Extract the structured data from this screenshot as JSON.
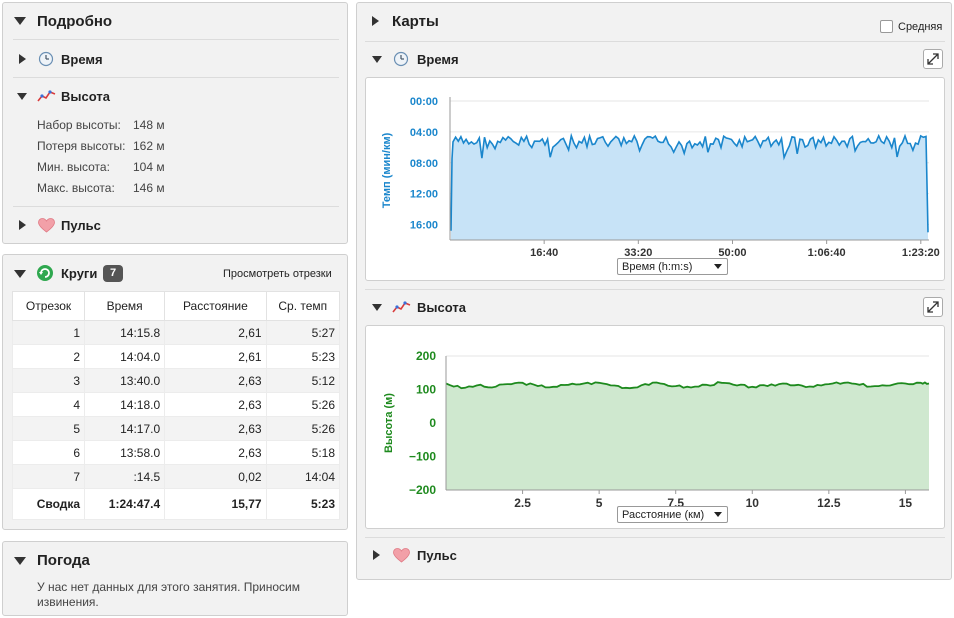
{
  "details": {
    "title": "Подробно",
    "time_label": "Время",
    "elevation": {
      "label": "Высота",
      "rows": [
        {
          "label": "Набор высоты:",
          "value": "148 м"
        },
        {
          "label": "Потеря высоты:",
          "value": "162 м"
        },
        {
          "label": "Мин. высота:",
          "value": "104 м"
        },
        {
          "label": "Макс. высота:",
          "value": "146 м"
        }
      ]
    },
    "pulse_label": "Пульс"
  },
  "laps": {
    "title": "Круги",
    "count": "7",
    "view_segments": "Просмотреть отрезки",
    "headers": [
      "Отрезок",
      "Время",
      "Расстояние",
      "Ср. темп"
    ],
    "rows": [
      [
        "1",
        "14:15.8",
        "2,61",
        "5:27"
      ],
      [
        "2",
        "14:04.0",
        "2,61",
        "5:23"
      ],
      [
        "3",
        "13:40.0",
        "2,63",
        "5:12"
      ],
      [
        "4",
        "14:18.0",
        "2,63",
        "5:26"
      ],
      [
        "5",
        "14:17.0",
        "2,63",
        "5:26"
      ],
      [
        "6",
        "13:58.0",
        "2,63",
        "5:18"
      ],
      [
        "7",
        ":14.5",
        "0,02",
        "14:04"
      ]
    ],
    "summary": [
      "Сводка",
      "1:24:47.4",
      "15,77",
      "5:23"
    ]
  },
  "weather": {
    "title": "Погода",
    "text_line1": "У нас нет данных для этого занятия. Приносим",
    "text_line2": "извинения."
  },
  "maps": {
    "title": "Карты",
    "average_label": "Средняя"
  },
  "time_chart": {
    "title": "Время",
    "selector": "Время (h:m:s)"
  },
  "elev_chart": {
    "title": "Высота",
    "selector": "Расстояние (км)"
  },
  "pulse_chart": {
    "title": "Пульс"
  },
  "colors": {
    "pace_line": "#1a86cc",
    "pace_fill": "#c7e3f7",
    "elev_line": "#1e8a1e",
    "elev_fill": "#cfe8cf"
  },
  "chart_data": [
    {
      "type": "area",
      "ylabel": "Темп (мин/км)",
      "y_ticks": [
        "00:00",
        "04:00",
        "08:00",
        "12:00",
        "16:00"
      ],
      "x_ticks": [
        "16:40",
        "33:20",
        "50:00",
        "1:06:40",
        "1:23:20"
      ],
      "ylim": [
        0,
        18
      ],
      "y_inverted": true,
      "xlim_seconds": [
        0,
        5087
      ],
      "series": [
        {
          "values_approx_min_per_km": 5.3
        }
      ]
    },
    {
      "type": "area",
      "ylabel": "Высота (м)",
      "y_ticks": [
        "200",
        "100",
        "0",
        "−100",
        "−200"
      ],
      "x_ticks": [
        "2.5",
        "5",
        "7.5",
        "10",
        "12.5",
        "15"
      ],
      "ylim": [
        -200,
        200
      ],
      "xlim": [
        0,
        15.77
      ],
      "x": [
        0,
        0.5,
        1,
        1.5,
        2,
        2.5,
        3,
        3.5,
        4,
        4.5,
        5,
        5.5,
        6,
        6.5,
        7,
        7.5,
        8,
        8.5,
        9,
        9.5,
        10,
        10.5,
        11,
        11.5,
        12,
        12.5,
        13,
        13.5,
        14,
        14.5,
        15,
        15.5,
        15.77
      ],
      "series": [
        {
          "values": [
            118,
            104,
            112,
            106,
            116,
            120,
            110,
            108,
            114,
            118,
            120,
            112,
            104,
            116,
            118,
            110,
            106,
            114,
            120,
            112,
            108,
            110,
            118,
            114,
            108,
            116,
            120,
            114,
            110,
            112,
            118,
            120,
            118
          ]
        }
      ]
    }
  ]
}
